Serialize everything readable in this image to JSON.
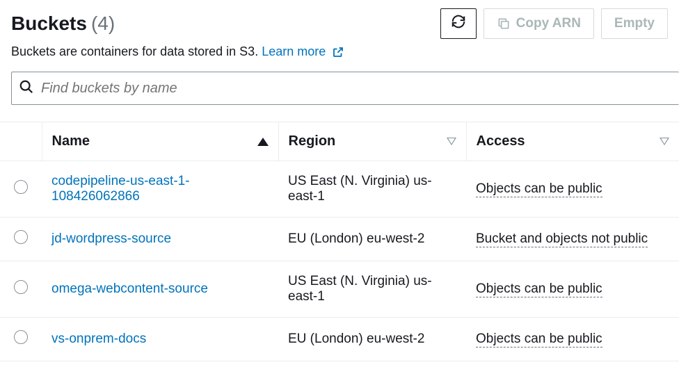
{
  "header": {
    "title": "Buckets",
    "count": "(4)",
    "refresh_label": "",
    "copy_arn_label": "Copy ARN",
    "empty_label": "Empty"
  },
  "description": {
    "text": "Buckets are containers for data stored in S3. ",
    "learn_more": "Learn more"
  },
  "search": {
    "placeholder": "Find buckets by name"
  },
  "columns": {
    "name": "Name",
    "region": "Region",
    "access": "Access"
  },
  "rows": [
    {
      "name": "codepipeline-us-east-1-108426062866",
      "region": "US East (N. Virginia) us-east-1",
      "access": "Objects can be public"
    },
    {
      "name": "jd-wordpress-source",
      "region": "EU (London) eu-west-2",
      "access": "Bucket and objects not public"
    },
    {
      "name": "omega-webcontent-source",
      "region": "US East (N. Virginia) us-east-1",
      "access": "Objects can be public"
    },
    {
      "name": "vs-onprem-docs",
      "region": "EU (London) eu-west-2",
      "access": "Objects can be public"
    }
  ]
}
